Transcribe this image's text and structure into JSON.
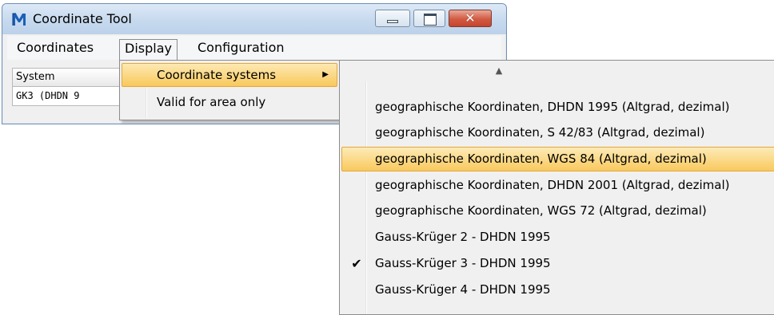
{
  "window": {
    "title": "Coordinate Tool",
    "close_glyph": "✕"
  },
  "menubar": {
    "items": [
      "Coordinates",
      "Display",
      "Configuration"
    ]
  },
  "grid": {
    "column_header": "System",
    "cell_value": "GK3 (DHDN 9"
  },
  "display_menu": {
    "items": [
      {
        "label": "Coordinate systems",
        "has_submenu": true,
        "arrow": "▶"
      },
      {
        "label": "Valid for area only"
      }
    ]
  },
  "submenu": {
    "scroll_glyph": "▲",
    "items": [
      {
        "label": "geographische Koordinaten, DHDN 1995 (Altgrad, dezimal)",
        "checked": false
      },
      {
        "label": "geographische Koordinaten, S 42/83 (Altgrad, dezimal)",
        "checked": false
      },
      {
        "label": "geographische Koordinaten, WGS 84  (Altgrad, dezimal)",
        "checked": false
      },
      {
        "label": "geographische Koordinaten, DHDN 2001 (Altgrad, dezimal)",
        "checked": false
      },
      {
        "label": "geographische Koordinaten, WGS 72  (Altgrad, dezimal)",
        "checked": false
      },
      {
        "label": "Gauss-Krüger 2 - DHDN 1995",
        "checked": false
      },
      {
        "label": "Gauss-Krüger 3 - DHDN 1995",
        "checked": true
      },
      {
        "label": "Gauss-Krüger 4 - DHDN 1995",
        "checked": false
      }
    ],
    "check_glyph": "✔"
  },
  "colors": {
    "highlight": "#f8c85c",
    "titlebar": "#c6d9ee",
    "close_button": "#d25a43"
  }
}
